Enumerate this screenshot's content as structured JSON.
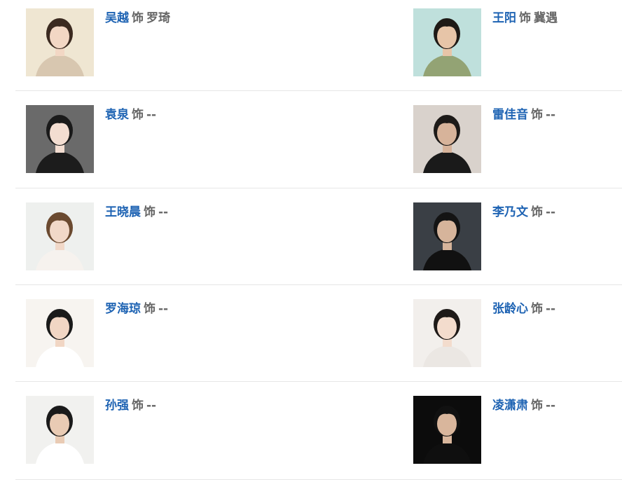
{
  "connector": "饰",
  "cast": [
    {
      "actor": "吴越",
      "role": "罗琦",
      "photo": {
        "bg": "#efe6d2",
        "hair": "#3b2a20",
        "skin": "#f2d7c4",
        "cloth": "#d8c7b0"
      }
    },
    {
      "actor": "王阳",
      "role": "冀遇",
      "photo": {
        "bg": "#bfe0dc",
        "hair": "#1e1a16",
        "skin": "#e7c5a8",
        "cloth": "#93a374"
      }
    },
    {
      "actor": "袁泉",
      "role": "--",
      "photo": {
        "bg": "#6a6a6a",
        "hair": "#1a1a1a",
        "skin": "#f3ddd1",
        "cloth": "#1c1c1c"
      }
    },
    {
      "actor": "雷佳音",
      "role": "--",
      "photo": {
        "bg": "#d9d2cc",
        "hair": "#1d1a18",
        "skin": "#d7b39a",
        "cloth": "#1a1a1a"
      }
    },
    {
      "actor": "王晓晨",
      "role": "--",
      "photo": {
        "bg": "#eef0ee",
        "hair": "#6b4a30",
        "skin": "#f1d8c8",
        "cloth": "#f6f2ee"
      }
    },
    {
      "actor": "李乃文",
      "role": "--",
      "photo": {
        "bg": "#3a3f45",
        "hair": "#141414",
        "skin": "#d6b49b",
        "cloth": "#111111"
      }
    },
    {
      "actor": "罗海琼",
      "role": "--",
      "photo": {
        "bg": "#f7f4f0",
        "hair": "#1a1a1a",
        "skin": "#f1d6c4",
        "cloth": "#ffffff"
      }
    },
    {
      "actor": "张龄心",
      "role": "--",
      "photo": {
        "bg": "#f2efec",
        "hair": "#1e1a18",
        "skin": "#f3dccd",
        "cloth": "#ebe7e3"
      }
    },
    {
      "actor": "孙强",
      "role": "--",
      "photo": {
        "bg": "#f1f1ef",
        "hair": "#1a1a1a",
        "skin": "#e9cbb4",
        "cloth": "#ffffff"
      }
    },
    {
      "actor": "凌潇肃",
      "role": "--",
      "photo": {
        "bg": "#0c0c0c",
        "hair": "#111111",
        "skin": "#d9b69c",
        "cloth": "#0f0f0f"
      }
    }
  ]
}
